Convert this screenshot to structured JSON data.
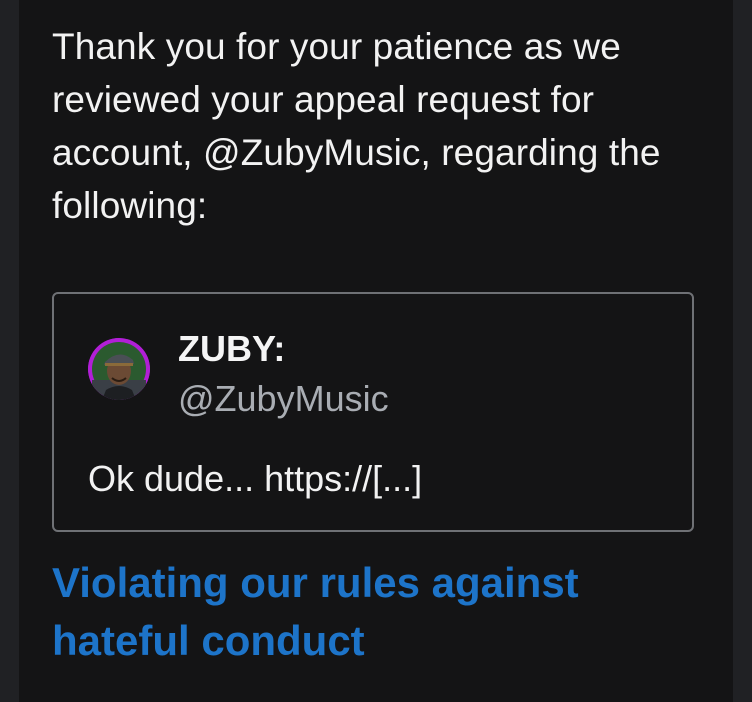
{
  "message": {
    "intro": "Thank you for your patience as we reviewed your appeal request for account, @ZubyMusic, regarding the following:"
  },
  "tweet": {
    "author_name": "ZUBY:",
    "author_handle": "@ZubyMusic",
    "text": "Ok dude... https://[...]"
  },
  "violation": {
    "label": "Violating our rules against hateful conduct"
  },
  "colors": {
    "background": "#141415",
    "text": "#f2f2f2",
    "muted": "#a9adb3",
    "link": "#1d74c9",
    "avatar_ring": "#b11fd6"
  }
}
